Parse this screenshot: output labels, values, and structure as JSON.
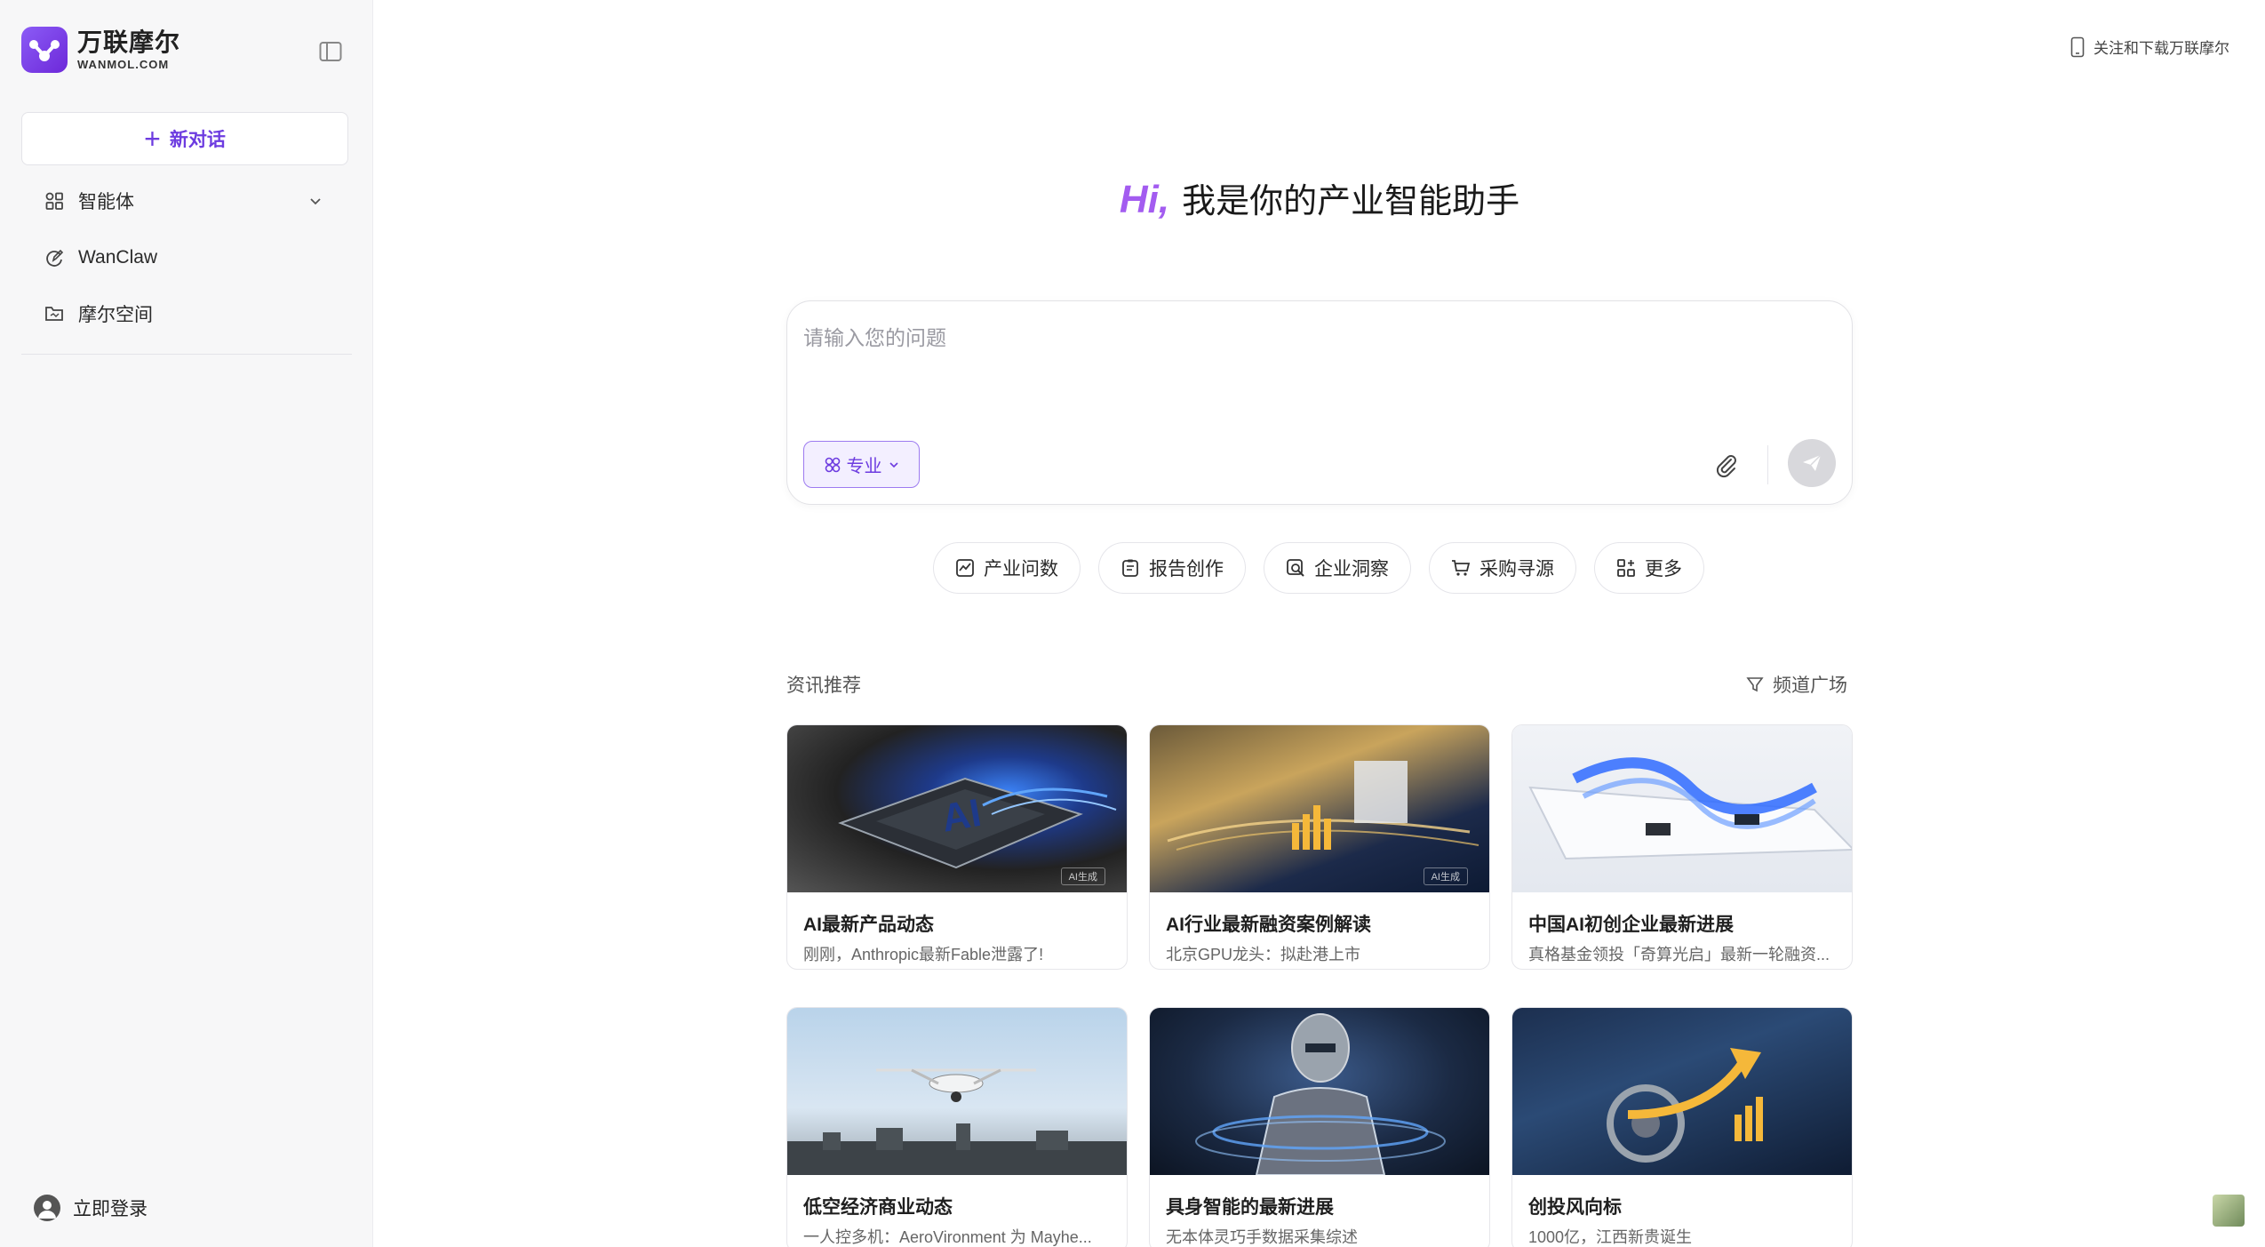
{
  "sidebar": {
    "logo_title": "万联摩尔",
    "logo_sub": "WANMOL.COM",
    "new_chat_label": "新对话",
    "items": [
      {
        "label": "智能体",
        "icon": "apps-icon",
        "has_chevron": true
      },
      {
        "label": "WanClaw",
        "icon": "edit-circle-icon",
        "has_chevron": false
      },
      {
        "label": "摩尔空间",
        "icon": "folder-icon",
        "has_chevron": false
      }
    ],
    "login_label": "立即登录"
  },
  "header": {
    "download_label": "关注和下载万联摩尔"
  },
  "hero": {
    "hi": "Hi,",
    "title": "我是你的产业智能助手"
  },
  "input": {
    "placeholder": "请输入您的问题",
    "mode_label": "专业"
  },
  "chips": [
    {
      "label": "产业问数",
      "icon": "chart-icon"
    },
    {
      "label": "报告创作",
      "icon": "report-icon"
    },
    {
      "label": "企业洞察",
      "icon": "insight-icon"
    },
    {
      "label": "采购寻源",
      "icon": "cart-icon"
    },
    {
      "label": "更多",
      "icon": "grid-plus-icon"
    }
  ],
  "news": {
    "section_title": "资讯推荐",
    "channel_label": "频道广场",
    "ai_tag": "AI生成",
    "cards": [
      {
        "title": "AI最新产品动态",
        "subtitle": "刚刚，Anthropic最新Fable泄露了!"
      },
      {
        "title": "AI行业最新融资案例解读",
        "subtitle": "北京GPU龙头：拟赴港上市"
      },
      {
        "title": "中国AI初创企业最新进展",
        "subtitle": "真格基金领投「奇算光启」最新一轮融资..."
      },
      {
        "title": "低空经济商业动态",
        "subtitle": "一人控多机：AeroVironment 为 Mayhe..."
      },
      {
        "title": "具身智能的最新进展",
        "subtitle": "无本体灵巧手数据采集综述"
      },
      {
        "title": "创投风向标",
        "subtitle": "1000亿，江西新贵诞生"
      }
    ]
  },
  "colors": {
    "accent": "#6d3ce0",
    "hi_gradient": "#a35cf0",
    "sidebar_bg": "#f7f7f8"
  }
}
